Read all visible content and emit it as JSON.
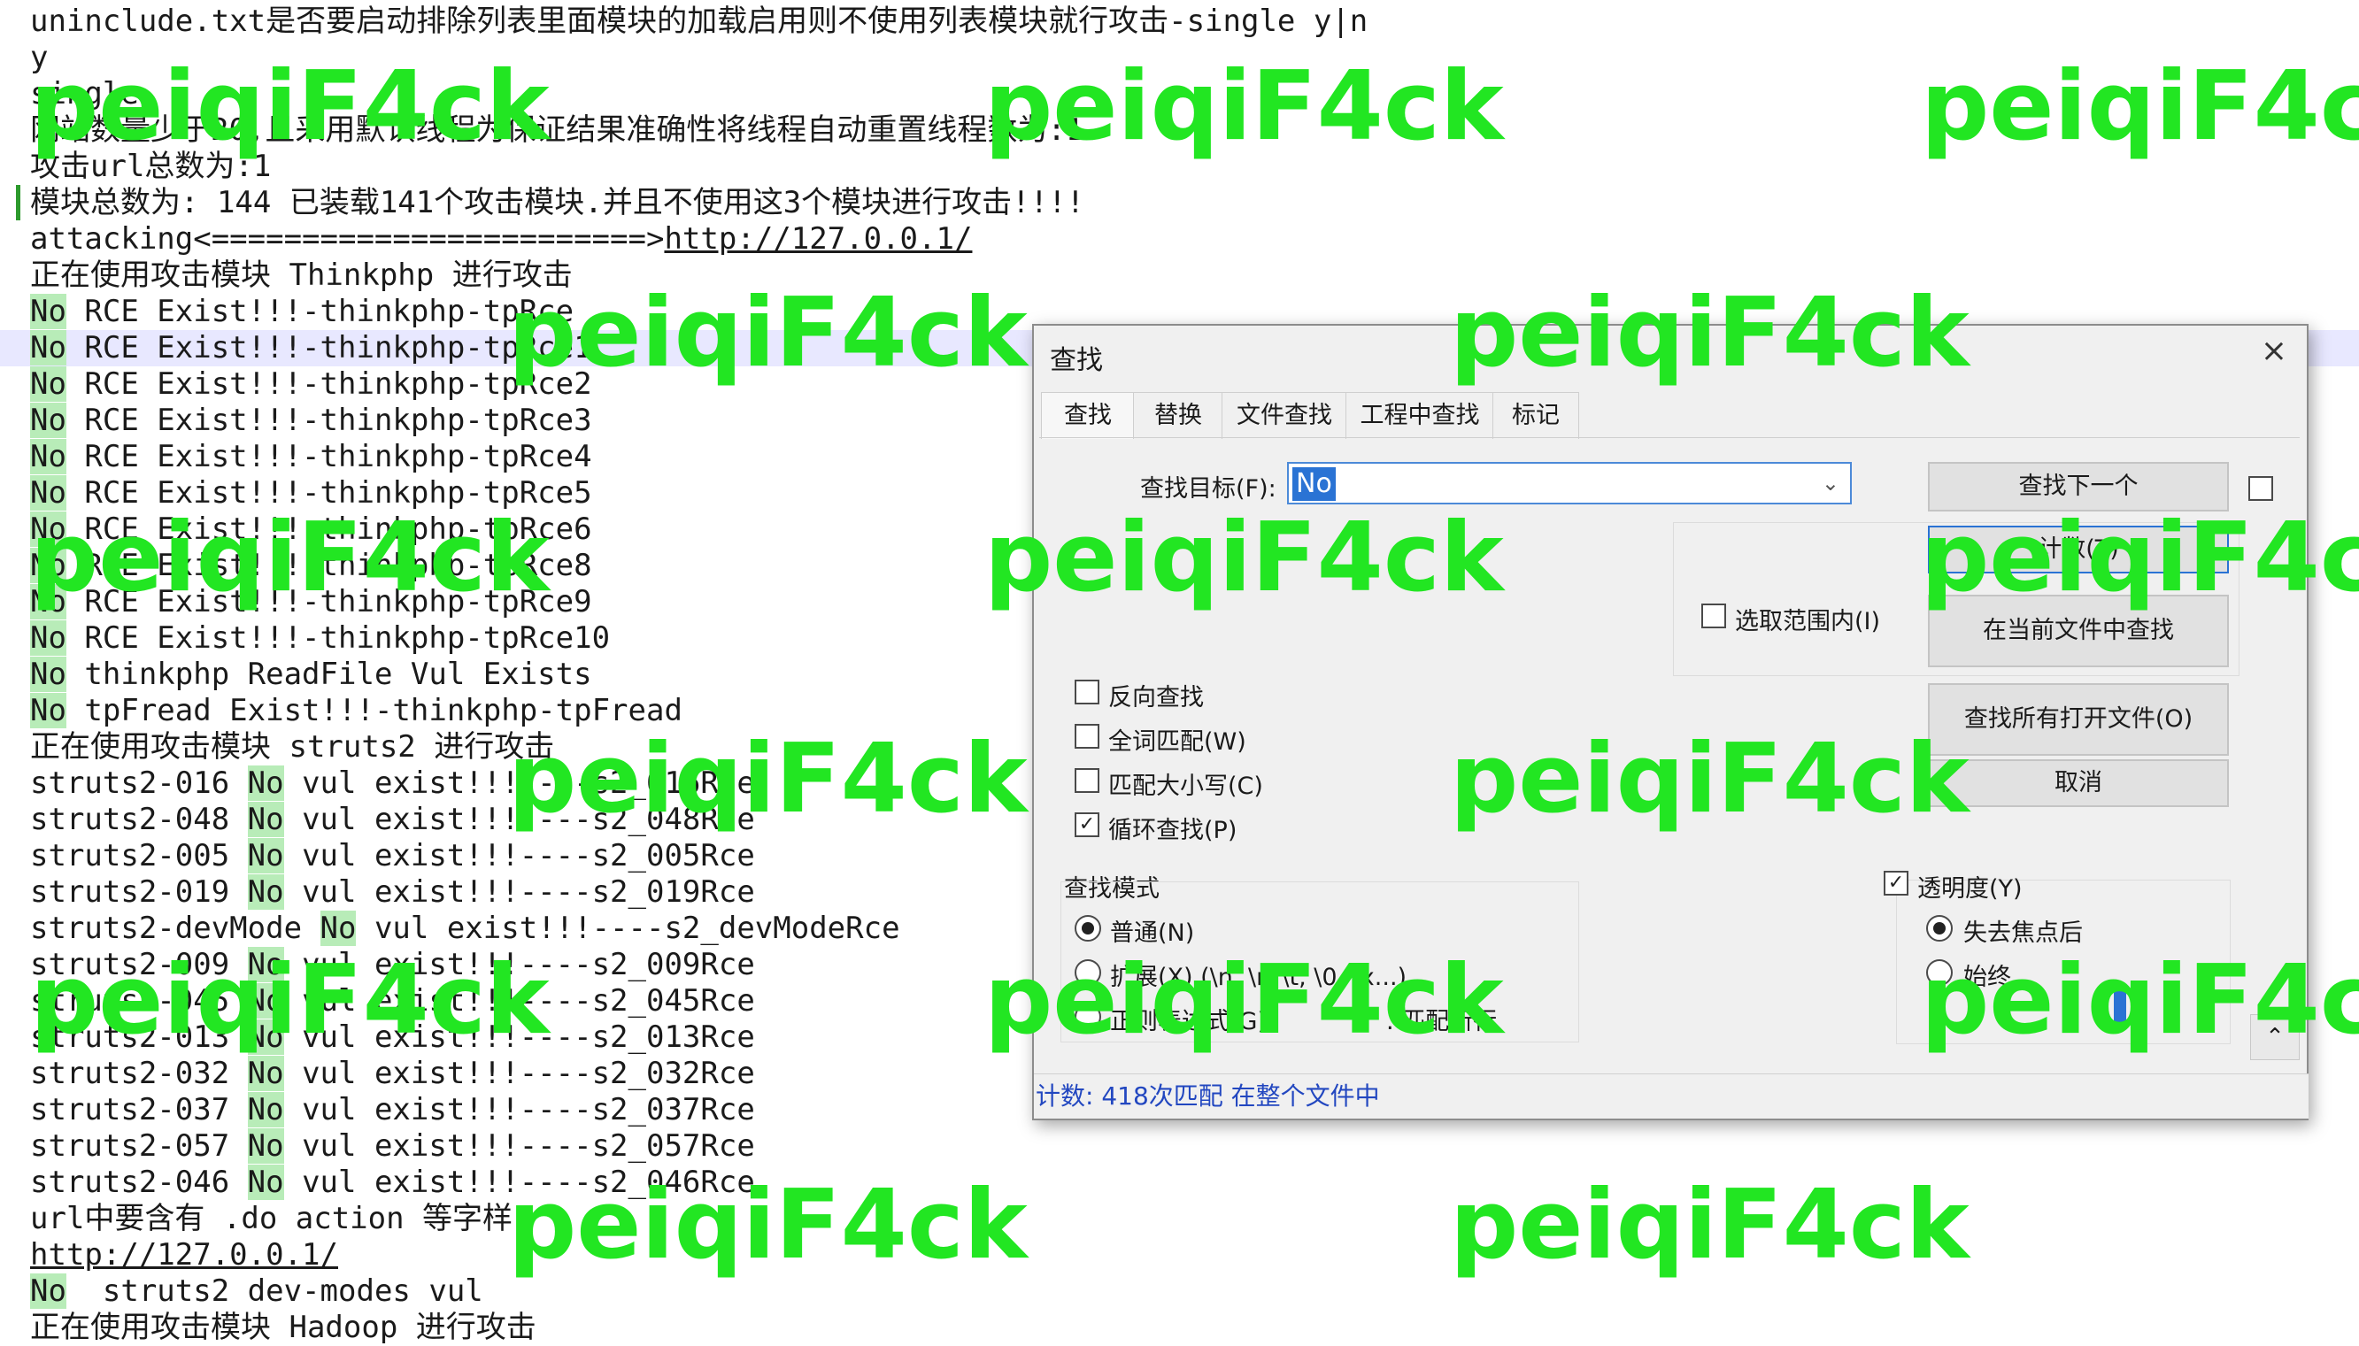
{
  "editor": {
    "lines": [
      {
        "text": "uninclude.txt是否要启动排除列表里面模块的加载启用则不使用列表模块就行攻击-single y|n"
      },
      {
        "text": "y"
      },
      {
        "text": "single"
      },
      {
        "text": "网站数量少于20,且采用默认线程为保证结果准确性将线程自动重置线程数为:1"
      },
      {
        "text": "攻击url总数为:1"
      },
      {
        "text": "模块总数为: 144 已装载141个攻击模块.并且不使用这3个模块进行攻击!!!!"
      },
      {
        "text": "attacking<========================>",
        "link": "http://127.0.0.1/"
      },
      {
        "text": "正在使用攻击模块 Thinkphp 进行攻击"
      },
      {
        "match": "No",
        "rest": " RCE Exist!!!-thinkphp-tpRce"
      },
      {
        "match": "No",
        "rest": " RCE Exist!!!-thinkphp-tpRce1"
      },
      {
        "match": "No",
        "rest": " RCE Exist!!!-thinkphp-tpRce2"
      },
      {
        "match": "No",
        "rest": " RCE Exist!!!-thinkphp-tpRce3"
      },
      {
        "match": "No",
        "rest": " RCE Exist!!!-thinkphp-tpRce4"
      },
      {
        "match": "No",
        "rest": " RCE Exist!!!-thinkphp-tpRce5"
      },
      {
        "match": "No",
        "rest": " RCE Exist!!!-thinkphp-tpRce6"
      },
      {
        "match": "No",
        "rest": " RCE Exist!!!-thinkphp-tpRce8"
      },
      {
        "match": "No",
        "rest": " RCE Exist!!!-thinkphp-tpRce9"
      },
      {
        "match": "No",
        "rest": " RCE Exist!!!-thinkphp-tpRce10"
      },
      {
        "match": "No",
        "rest": " thinkphp ReadFile Vul Exists"
      },
      {
        "match": "No",
        "rest": " tpFread Exist!!!-thinkphp-tpFread"
      },
      {
        "text": "正在使用攻击模块 struts2 进行攻击"
      },
      {
        "pre": "struts2-016 ",
        "match": "No",
        "rest": " vul exist!!!----s2_016Rce"
      },
      {
        "pre": "struts2-048 ",
        "match": "No",
        "rest": " vul exist!!!----s2_048Rce"
      },
      {
        "pre": "struts2-005 ",
        "match": "No",
        "rest": " vul exist!!!----s2_005Rce"
      },
      {
        "pre": "struts2-019 ",
        "match": "No",
        "rest": " vul exist!!!----s2_019Rce"
      },
      {
        "pre": "struts2-devMode ",
        "match": "No",
        "rest": " vul exist!!!----s2_devModeRce"
      },
      {
        "pre": "struts2-009 ",
        "match": "No",
        "rest": " vul exist!!!----s2_009Rce"
      },
      {
        "pre": "struts2-045 ",
        "match": "No",
        "rest": " vul exist!!!----s2_045Rce"
      },
      {
        "pre": "struts2-013 ",
        "match": "No",
        "rest": " vul exist!!!----s2_013Rce"
      },
      {
        "pre": "struts2-032 ",
        "match": "No",
        "rest": " vul exist!!!----s2_032Rce"
      },
      {
        "pre": "struts2-037 ",
        "match": "No",
        "rest": " vul exist!!!----s2_037Rce"
      },
      {
        "pre": "struts2-057 ",
        "match": "No",
        "rest": " vul exist!!!----s2_057Rce"
      },
      {
        "pre": "struts2-046 ",
        "match": "No",
        "rest": " vul exist!!!----s2_046Rce"
      },
      {
        "text": "url中要含有 .do action 等字样"
      },
      {
        "link": "http://127.0.0.1/"
      },
      {
        "match": "No",
        "rest": "  struts2 dev-modes vul"
      },
      {
        "text": "正在使用攻击模块 Hadoop 进行攻击"
      }
    ]
  },
  "dialog": {
    "title": "查找",
    "close": "×",
    "tabs": [
      "查找",
      "替换",
      "文件查找",
      "工程中查找",
      "标记"
    ],
    "find_target_label": "查找目标(F):",
    "find_target_value": "No",
    "buttons": {
      "find_next": "查找下一个",
      "count": "计数(T)",
      "find_in_current": "在当前文件中查找",
      "find_in_all_open": "查找所有打开文件(O)",
      "cancel": "取消"
    },
    "in_selection": "选取范围内(I)",
    "options": [
      {
        "label": "反向查找",
        "checked": false
      },
      {
        "label": "全词匹配(W)",
        "checked": false
      },
      {
        "label": "匹配大小写(C)",
        "checked": false
      },
      {
        "label": "循环查找(P)",
        "checked": true
      }
    ],
    "search_mode": {
      "title": "查找模式",
      "normal": "普通(N)",
      "extended": "扩展(X) (\\n, \\r, \\t, \\0, \\x...)",
      "regex": "正则表达式(G)",
      "regex_suffix": ". 匹配新行"
    },
    "transparency": {
      "label": "透明度(Y)",
      "on_lose_focus": "失去焦点后",
      "always": "始终"
    },
    "status": "计数: 418次匹配 在整个文件中"
  },
  "watermark": "peiqiF4ck",
  "colors": {
    "match_highlight": "#b8ecb8",
    "watermark": "#22e622",
    "status_text": "#2247c0",
    "selection": "#2a73d4"
  }
}
